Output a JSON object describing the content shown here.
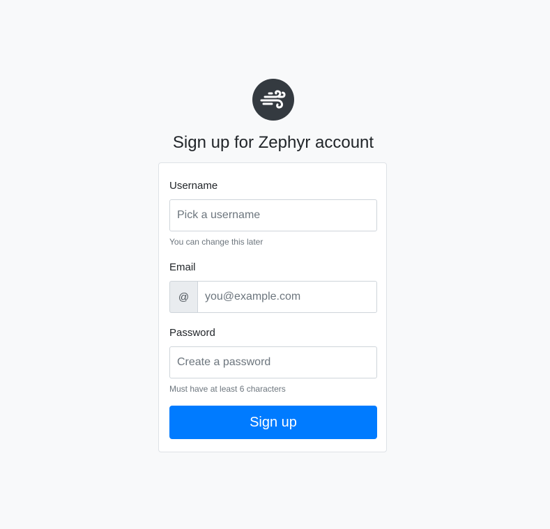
{
  "header": {
    "logo_icon": "wind-icon",
    "title": "Sign up for Zephyr account"
  },
  "form": {
    "username": {
      "label": "Username",
      "placeholder": "Pick a username",
      "value": "",
      "help": "You can change this later"
    },
    "email": {
      "label": "Email",
      "addon": "@",
      "placeholder": "you@example.com",
      "value": ""
    },
    "password": {
      "label": "Password",
      "placeholder": "Create a password",
      "value": "",
      "help": "Must have at least 6 characters"
    },
    "submit_label": "Sign up"
  },
  "colors": {
    "background": "#f8f9fa",
    "logo_bg": "#343a40",
    "primary": "#007bff",
    "text": "#212529",
    "muted": "#6c757d"
  }
}
